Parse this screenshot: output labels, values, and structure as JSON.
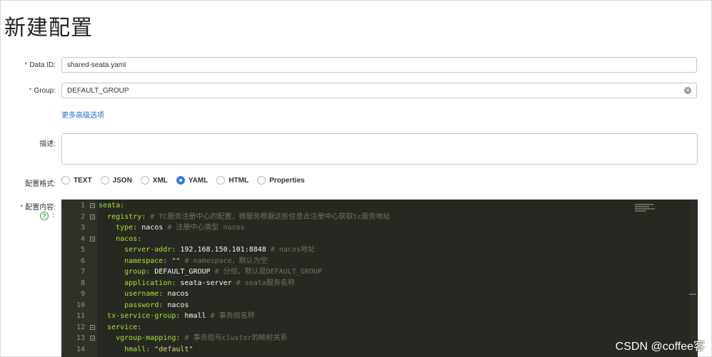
{
  "page": {
    "title": "新建配置"
  },
  "form": {
    "data_id": {
      "label": "Data ID:",
      "value": "shared-seata.yaml"
    },
    "group": {
      "label": "Group:",
      "value": "DEFAULT_GROUP"
    },
    "advanced_link": "更多高级选项",
    "description": {
      "label": "描述:",
      "value": ""
    },
    "format": {
      "label": "配置格式:",
      "options": [
        "TEXT",
        "JSON",
        "XML",
        "YAML",
        "HTML",
        "Properties"
      ],
      "selected": "YAML"
    },
    "content": {
      "label": "配置内容:",
      "help_icon": "question-circle-icon",
      "help_colon": ":"
    }
  },
  "editor": {
    "lines": [
      {
        "n": "1",
        "indent": "",
        "key": "seata:",
        "val": "",
        "cmt": "",
        "fold": true
      },
      {
        "n": "2",
        "indent": "  ",
        "key": "registry:",
        "val": "",
        "cmt": " # TC服务注册中心的配置，微服务根据这些信息去注册中心获取tc服务地址",
        "fold": true
      },
      {
        "n": "3",
        "indent": "    ",
        "key": "type:",
        "val": " nacos",
        "cmt": " # 注册中心类型 nacos",
        "fold": false
      },
      {
        "n": "4",
        "indent": "    ",
        "key": "nacos:",
        "val": "",
        "cmt": "",
        "fold": true
      },
      {
        "n": "5",
        "indent": "      ",
        "key": "server-addr:",
        "val": " 192.168.150.101:8848",
        "cmt": " # nacos地址",
        "fold": false
      },
      {
        "n": "6",
        "indent": "      ",
        "key": "namespace:",
        "val": " \"\"",
        "cmt": " # namespace，默认为空",
        "fold": false
      },
      {
        "n": "7",
        "indent": "      ",
        "key": "group:",
        "val": " DEFAULT_GROUP",
        "cmt": " # 分组，默认是DEFAULT_GROUP",
        "fold": false
      },
      {
        "n": "8",
        "indent": "      ",
        "key": "application:",
        "val": " seata-server",
        "cmt": " # seata服务名称",
        "fold": false
      },
      {
        "n": "9",
        "indent": "      ",
        "key": "username:",
        "val": " nacos",
        "cmt": "",
        "fold": false
      },
      {
        "n": "10",
        "indent": "      ",
        "key": "password:",
        "val": " nacos",
        "cmt": "",
        "fold": false
      },
      {
        "n": "11",
        "indent": "  ",
        "key": "tx-service-group:",
        "val": " hmall",
        "cmt": " # 事务组名称",
        "fold": false
      },
      {
        "n": "12",
        "indent": "  ",
        "key": "service:",
        "val": "",
        "cmt": "",
        "fold": true
      },
      {
        "n": "13",
        "indent": "    ",
        "key": "vgroup-mapping:",
        "val": "",
        "cmt": " # 事务组与cluster的映射关系",
        "fold": true
      },
      {
        "n": "14",
        "indent": "      ",
        "key": "hmall:",
        "val": " \"default\"",
        "cmt": "",
        "fold": false
      }
    ]
  },
  "watermark": "CSDN @coffee客"
}
